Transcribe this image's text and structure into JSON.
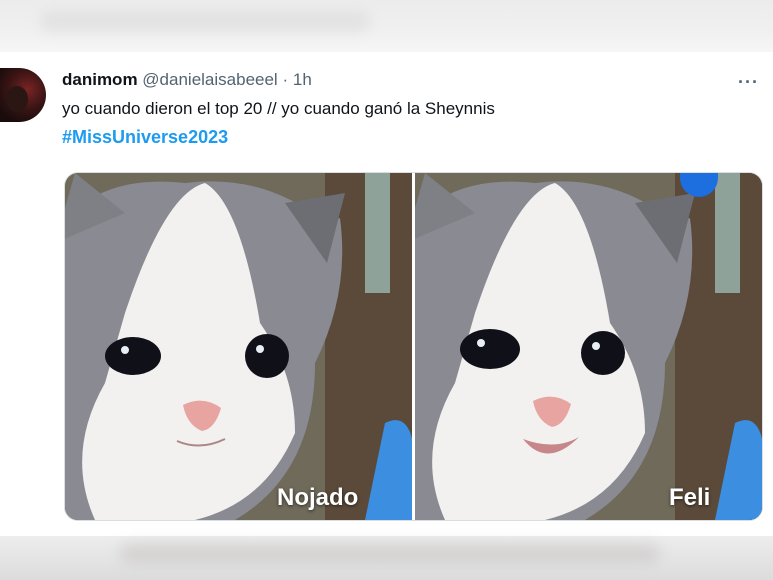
{
  "tweet": {
    "display_name": "danimom",
    "handle": "@danielaisabeeel",
    "separator": "·",
    "time": "1h",
    "more_label": "···",
    "text": "yo cuando dieron el top 20 // yo cuando ganó la Sheynnis",
    "hashtag": "#MissUniverse2023",
    "media": {
      "left_caption": "Nojado",
      "right_caption": "Feli"
    }
  },
  "icons": {
    "avatar": "avatar-photo",
    "more": "more-options-icon"
  },
  "colors": {
    "hashtag": "#1d9bf0",
    "text": "#0f1419",
    "secondary": "#536471"
  }
}
